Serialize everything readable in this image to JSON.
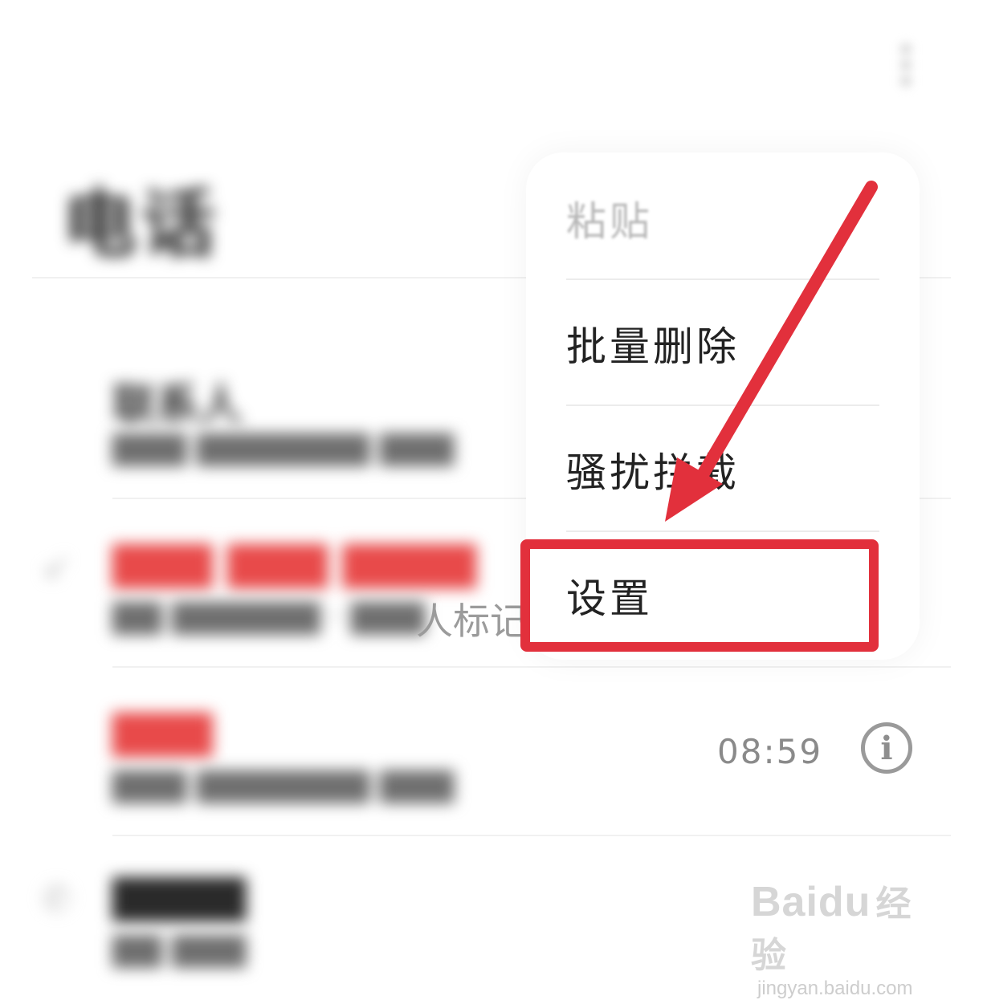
{
  "header": {
    "title": "电话",
    "more_icon": "more-vertical-icon"
  },
  "call_log": [
    {
      "name": "联系人",
      "subtitle": "",
      "time": "",
      "missed": false
    },
    {
      "name": "",
      "subtitle": "人标记",
      "time": "",
      "missed": true
    },
    {
      "name": "",
      "subtitle": "",
      "time": "08:59",
      "missed": true
    },
    {
      "name": "",
      "subtitle": "",
      "time": "",
      "missed": false
    }
  ],
  "menu": {
    "items": [
      {
        "label": "粘贴",
        "enabled": false
      },
      {
        "label": "批量删除",
        "enabled": true
      },
      {
        "label": "骚扰拦截",
        "enabled": true
      },
      {
        "label": "设置",
        "enabled": true,
        "highlighted": true
      }
    ]
  },
  "annotation": {
    "color": "#e2303c",
    "target": "设置"
  },
  "watermark": {
    "logo_latin": "Baidu",
    "logo_cn": "经验",
    "url": "jingyan.baidu.com"
  },
  "colors": {
    "missed_red": "#e84a4a",
    "annotation_red": "#e2303c"
  }
}
